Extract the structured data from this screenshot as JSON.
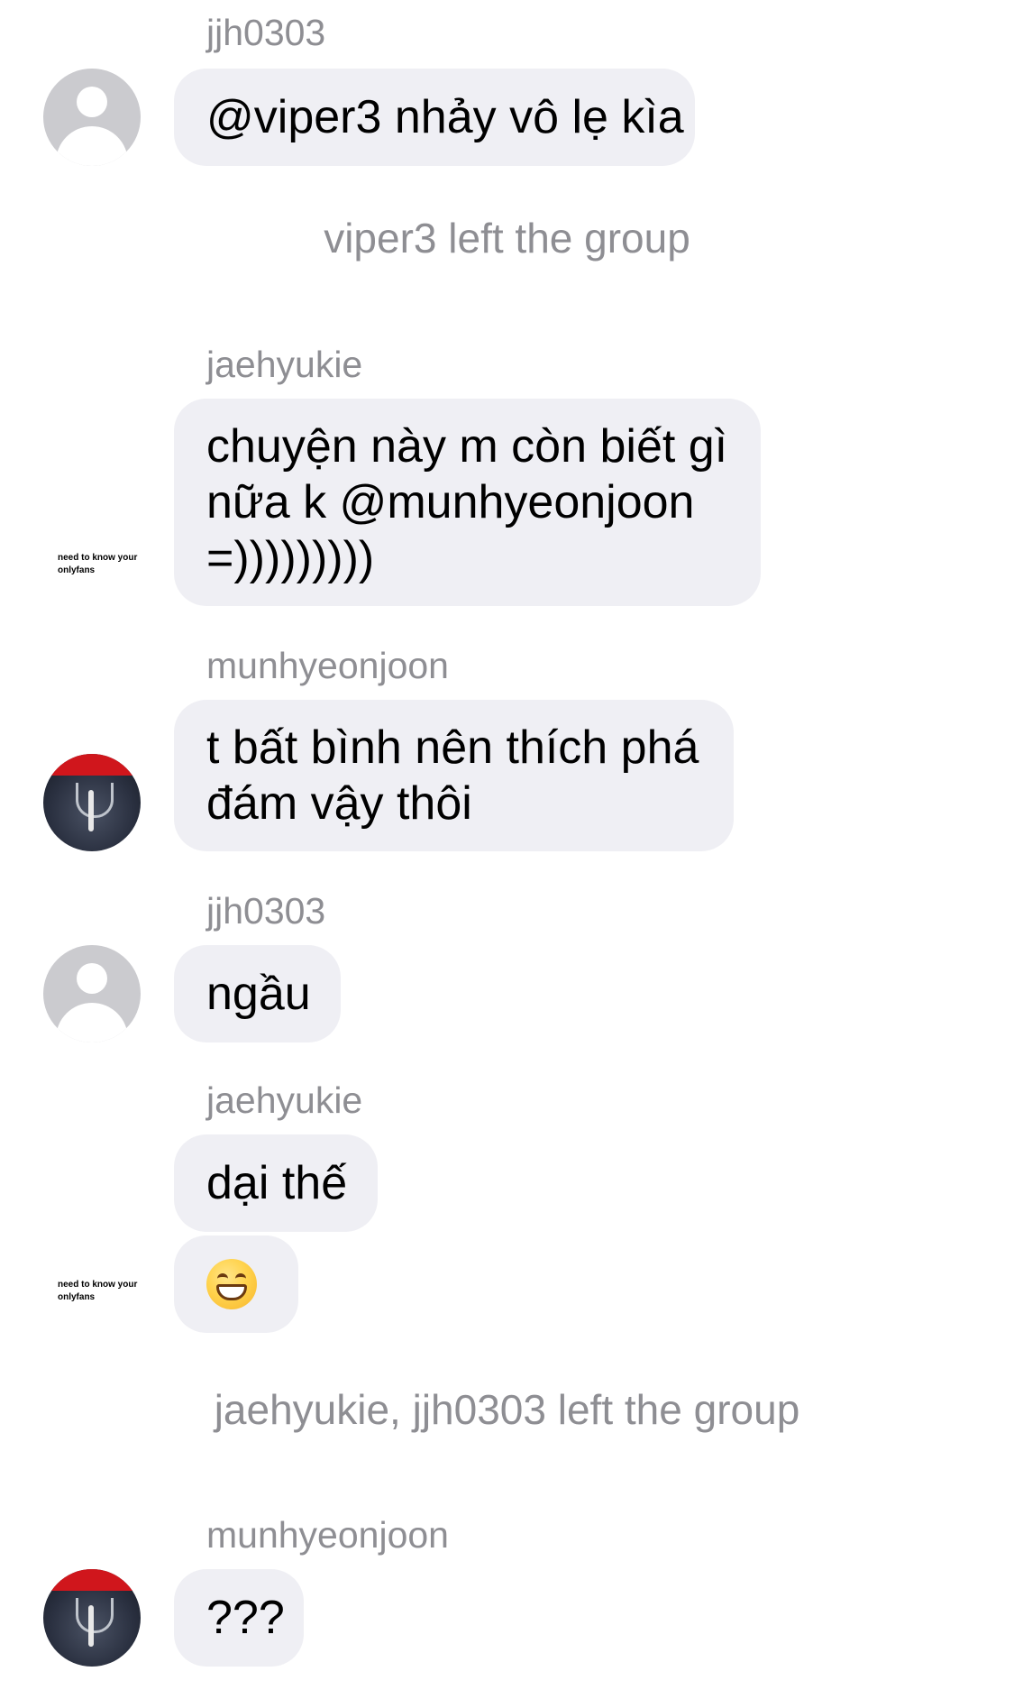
{
  "messages": [
    {
      "sender": "jjh0303",
      "text": "@viper3 nhảy vô lẹ kìa"
    },
    {
      "system": "viper3 left the group"
    },
    {
      "sender": "jaehyukie",
      "lines": [
        "chuyện này m còn biết gì",
        "nữa k @munhyeonjoon",
        "=)))))))))"
      ]
    },
    {
      "sender": "munhyeonjoon",
      "lines": [
        "t bất bình nên thích phá",
        "đám vậy thôi"
      ]
    },
    {
      "sender": "jjh0303",
      "text": "ngầu"
    },
    {
      "sender": "jaehyukie",
      "text": "dại thế",
      "emoji": "grinning-face-with-smiling-eyes"
    },
    {
      "system": "jaehyukie, jjh0303 left the group"
    },
    {
      "sender": "munhyeonjoon",
      "text": "???"
    }
  ],
  "avatars": {
    "jaehyukie_caption": "need to know your onlyfans"
  },
  "colors": {
    "bubble": "#efeff4",
    "meta_text": "#8e8e93",
    "message_text": "#000000",
    "default_avatar": "#cbcbcf"
  }
}
